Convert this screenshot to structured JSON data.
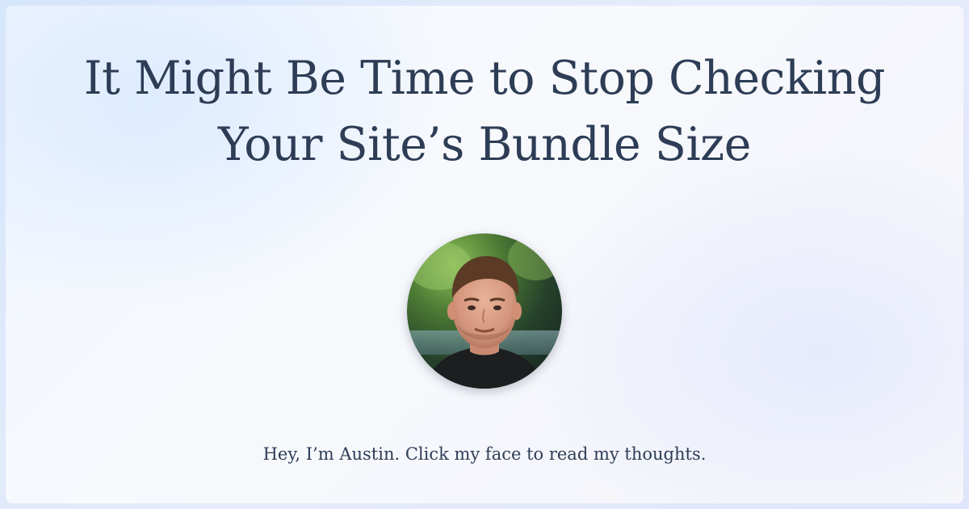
{
  "post": {
    "title_line_1": "It Might Be Time to Stop Checking",
    "title_line_2": "Your Site’s Bundle Size"
  },
  "author": {
    "avatar_icon": "author-photo",
    "tagline": "Hey, I’m Austin. Click my face to read my thoughts."
  },
  "colors": {
    "text": "#2e3d56",
    "background": "#f5f7fc",
    "border": "#d6e6fb"
  }
}
